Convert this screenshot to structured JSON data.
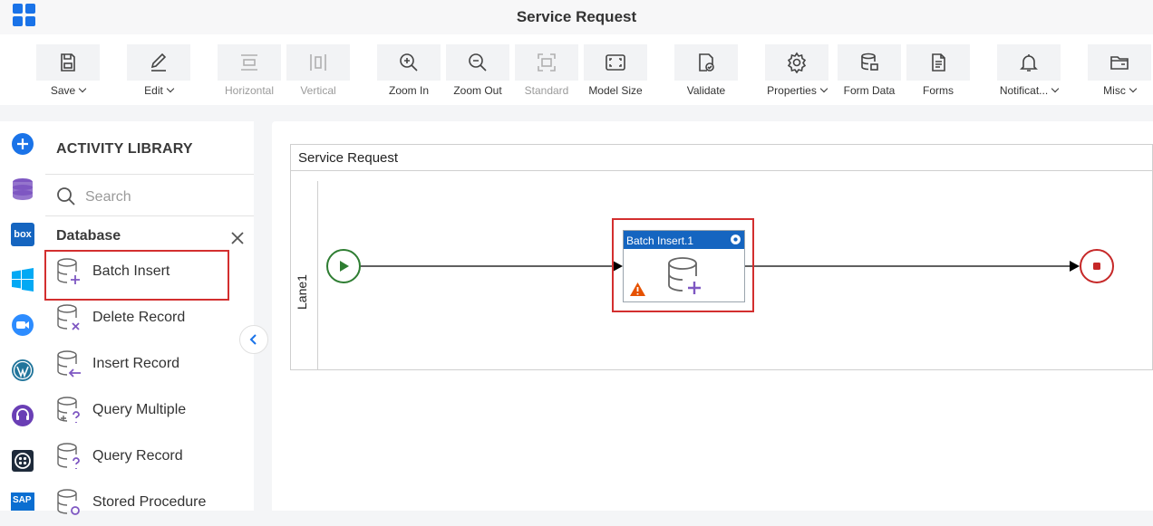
{
  "app": {
    "title": "Service Request"
  },
  "toolbar": {
    "save": "Save",
    "edit": "Edit",
    "horizontal": "Horizontal",
    "vertical": "Vertical",
    "zoom_in": "Zoom In",
    "zoom_out": "Zoom Out",
    "standard": "Standard",
    "model_size": "Model Size",
    "validate": "Validate",
    "properties": "Properties",
    "form_data": "Form Data",
    "forms": "Forms",
    "notifications": "Notificat...",
    "misc": "Misc"
  },
  "library": {
    "heading": "ACTIVITY LIBRARY",
    "search_placeholder": "Search",
    "category": "Database",
    "items": [
      {
        "label": "Batch Insert"
      },
      {
        "label": "Delete Record"
      },
      {
        "label": "Insert Record"
      },
      {
        "label": "Query Multiple"
      },
      {
        "label": "Query Record"
      },
      {
        "label": "Stored Procedure"
      }
    ]
  },
  "rail": {
    "icons": [
      "add-icon",
      "database-icon",
      "box-icon",
      "windows-icon",
      "zoom-icon",
      "wordpress-icon",
      "support-icon",
      "twilio-icon",
      "sap-icon"
    ],
    "box_text": "box",
    "sap_text": "SAP"
  },
  "canvas": {
    "pool_title": "Service Request",
    "lane_label": "Lane1",
    "task_label": "Batch Insert.1"
  },
  "colors": {
    "accent": "#1a73e8",
    "highlight": "#d32f2f",
    "task_header": "#1565c0",
    "start": "#2e7d32",
    "end": "#c62828",
    "icon_purple": "#7e57c2"
  }
}
